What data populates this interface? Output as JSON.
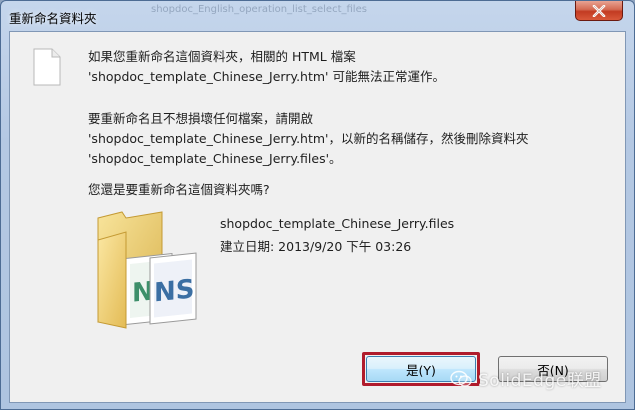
{
  "dialog": {
    "title": "重新命名資料夾",
    "background_tabs": [
      "shopdoc_English_operation_list_select_files"
    ],
    "message1": {
      "line1": "如果您重新命名這個資料夾，相關的 HTML 檔案",
      "line2": "'shopdoc_template_Chinese_Jerry.htm' 可能無法正常運作。"
    },
    "message2": {
      "line1": "要重新命名且不想損壞任何檔案，請開啟",
      "line2": "'shopdoc_template_Chinese_Jerry.htm'，以新的名稱儲存，然後刪除資料夾",
      "line3": "'shopdoc_template_Chinese_Jerry.files'。"
    },
    "question": "您還是要重新命名這個資料夾嗎?",
    "folder": {
      "name": "shopdoc_template_Chinese_Jerry.files",
      "created": "建立日期: 2013/9/20 下午 03:26"
    },
    "buttons": {
      "yes_label": "是(Y)",
      "no_label": "否(N)"
    },
    "watermark": "SolidEdge联盟",
    "colors": {
      "highlight_border": "#b01b2c",
      "title_bar": "#b4c8e3",
      "close_button": "#c23b22"
    }
  }
}
